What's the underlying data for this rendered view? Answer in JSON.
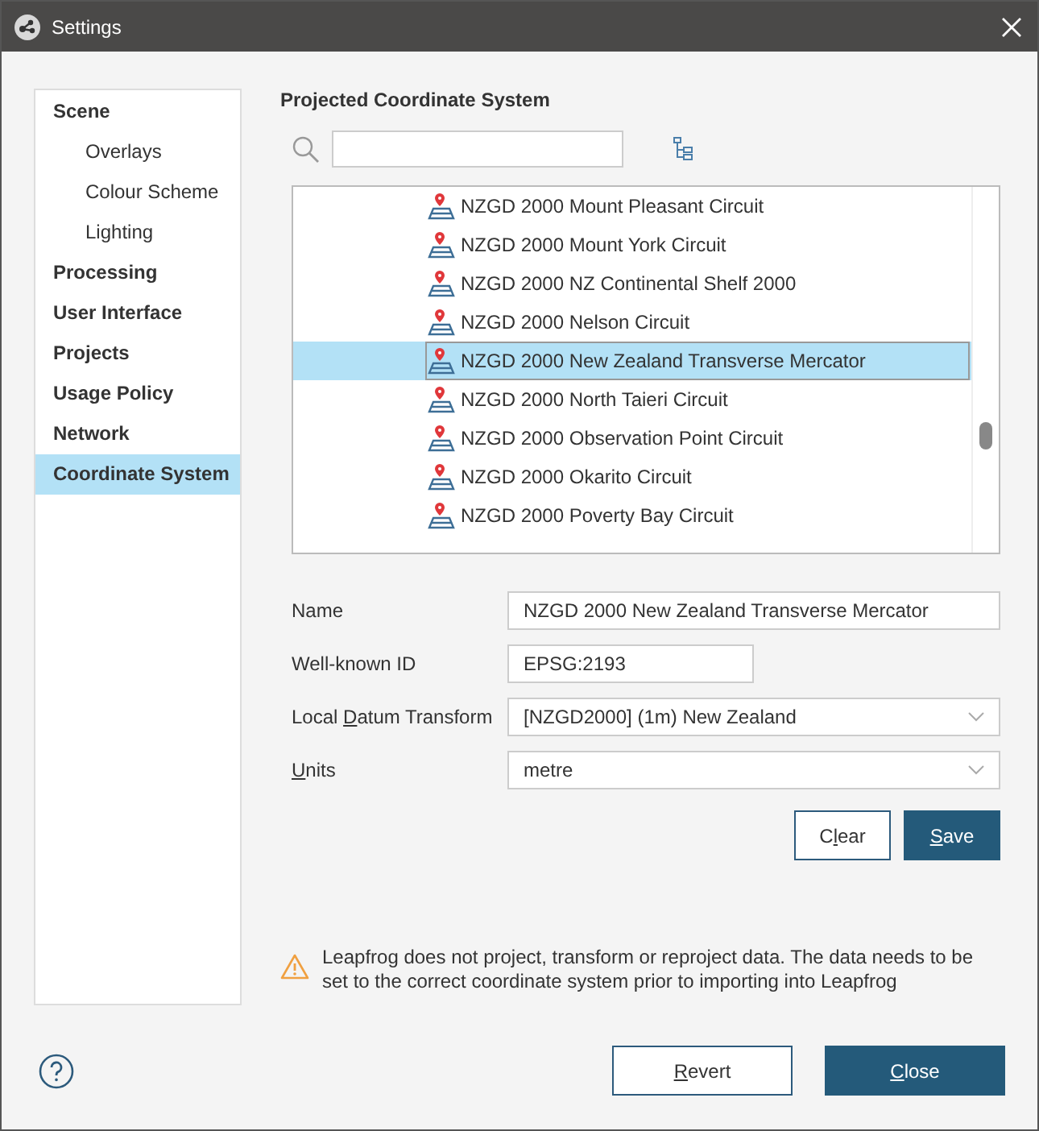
{
  "window": {
    "title": "Settings"
  },
  "sidebar": {
    "items": [
      {
        "label": "Scene",
        "kind": "section",
        "selected": false
      },
      {
        "label": "Overlays",
        "kind": "sub",
        "selected": false
      },
      {
        "label": "Colour Scheme",
        "kind": "sub",
        "selected": false
      },
      {
        "label": "Lighting",
        "kind": "sub",
        "selected": false
      },
      {
        "label": "Processing",
        "kind": "section",
        "selected": false
      },
      {
        "label": "User Interface",
        "kind": "section",
        "selected": false
      },
      {
        "label": "Projects",
        "kind": "section",
        "selected": false
      },
      {
        "label": "Usage Policy",
        "kind": "section",
        "selected": false
      },
      {
        "label": "Network",
        "kind": "section",
        "selected": false
      },
      {
        "label": "Coordinate System",
        "kind": "section",
        "selected": true
      }
    ]
  },
  "panel": {
    "heading": "Projected Coordinate System",
    "list": {
      "rows": [
        {
          "label": "NZGD 2000 Mount Pleasant Circuit",
          "selected": false
        },
        {
          "label": "NZGD 2000 Mount York Circuit",
          "selected": false
        },
        {
          "label": "NZGD 2000 NZ Continental Shelf 2000",
          "selected": false
        },
        {
          "label": "NZGD 2000 Nelson Circuit",
          "selected": false
        },
        {
          "label": "NZGD 2000 New Zealand Transverse Mercator",
          "selected": true
        },
        {
          "label": "NZGD 2000 North Taieri Circuit",
          "selected": false
        },
        {
          "label": "NZGD 2000 Observation Point Circuit",
          "selected": false
        },
        {
          "label": "NZGD 2000 Okarito Circuit",
          "selected": false
        },
        {
          "label": "NZGD 2000 Poverty Bay Circuit",
          "selected": false
        }
      ]
    },
    "form": [
      {
        "label": [
          {
            "text": "Name",
            "underline": false
          }
        ],
        "kind": "text",
        "value": "NZGD 2000 New Zealand Transverse Mercator",
        "wide": true
      },
      {
        "label": [
          {
            "text": "Well-known ID",
            "underline": false
          }
        ],
        "kind": "text",
        "value": "EPSG:2193",
        "wide": false
      },
      {
        "label": [
          {
            "text": "Local ",
            "underline": false
          },
          {
            "text": "D",
            "underline": true
          },
          {
            "text": "atum Transform",
            "underline": false
          }
        ],
        "kind": "select",
        "value": "[NZGD2000] (1m) New Zealand",
        "wide": true
      },
      {
        "label": [
          {
            "text": "U",
            "underline": true
          },
          {
            "text": "nits",
            "underline": false
          }
        ],
        "kind": "select",
        "value": "metre",
        "wide": true
      }
    ],
    "form_buttons": [
      {
        "label": [
          {
            "text": "C",
            "underline": false
          },
          {
            "text": "l",
            "underline": true
          },
          {
            "text": "ear",
            "underline": false
          }
        ],
        "kind": "secondary"
      },
      {
        "label": [
          {
            "text": "S",
            "underline": true
          },
          {
            "text": "ave",
            "underline": false
          }
        ],
        "kind": "primary"
      }
    ],
    "warning": "Leapfrog does not project, transform or reproject data. The data needs to be set to the correct coordinate system prior to importing into Leapfrog"
  },
  "footer_buttons": [
    {
      "label": [
        {
          "text": "R",
          "underline": true
        },
        {
          "text": "evert",
          "underline": false
        }
      ],
      "kind": "secondary"
    },
    {
      "label": [
        {
          "text": "C",
          "underline": true
        },
        {
          "text": "lose",
          "underline": false
        }
      ],
      "kind": "primary"
    }
  ]
}
